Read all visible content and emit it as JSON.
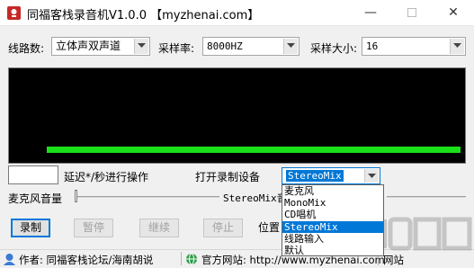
{
  "window": {
    "title": "同福客栈录音机V1.0.0 【myzhenai.com】",
    "minimize_glyph": "—",
    "close_glyph": "✕"
  },
  "settings": {
    "line_label": "线路数:",
    "line_value": "立体声双声道",
    "rate_label": "采样率:",
    "rate_value": "8000HZ",
    "size_label": "采样大小:",
    "size_value": "16"
  },
  "visualizer": {
    "level_color": "#1ae01a"
  },
  "controls": {
    "delay_value": "",
    "delay_label": "延迟*/秒进行操作",
    "device_label": "打开录制设备",
    "device_value": "StereoMix",
    "mic_volume_label": "麦克风音量",
    "stereomix_label": "StereoMix音"
  },
  "buttons": {
    "record": "录制",
    "pause": "暂停",
    "continue": "继续",
    "stop": "停止",
    "location_partial": "位置"
  },
  "device_list": {
    "items": [
      "麦克风",
      "MonoMix",
      "CD唱机",
      "StereoMix",
      "线路输入",
      "默认"
    ],
    "selected": "StereoMix"
  },
  "status": {
    "author": "作者: 同福客栈论坛/海南胡说",
    "website": "官方网站: http://www.myzhenai.com",
    "extra": "网站"
  },
  "colors": {
    "accent": "#0078d7",
    "level_bar": "#1ae01a",
    "visualizer_bg": "#000000"
  },
  "icons": {
    "app": "red-recorder-icon",
    "author": "avatar-icon",
    "website": "globe-icon"
  }
}
